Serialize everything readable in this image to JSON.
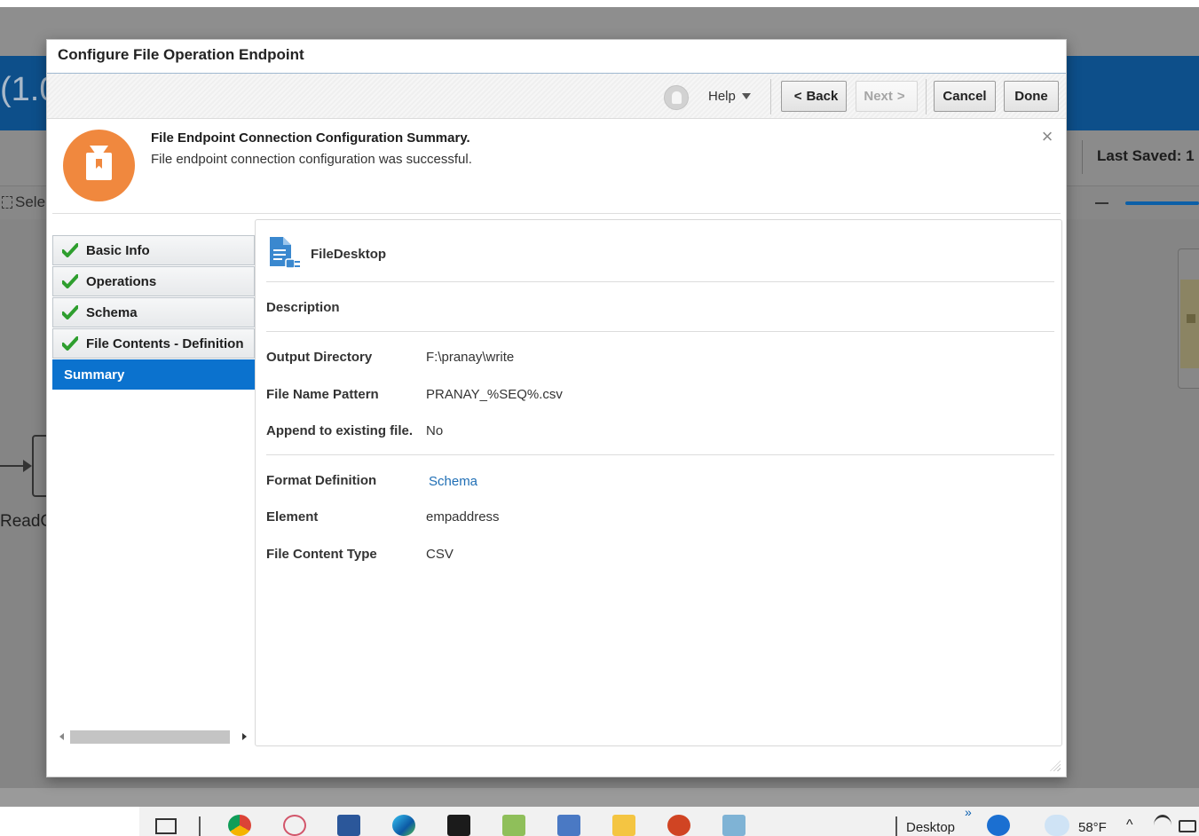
{
  "background_app": {
    "version_fragment": "(1.0",
    "last_saved_label": "Last Saved: 1",
    "select_label": "Sele",
    "node_label": "ReadC"
  },
  "dialog": {
    "title": "Configure File Operation Endpoint",
    "toolbar": {
      "help_label": "Help",
      "back_label": "Back",
      "back_chevron": "<",
      "next_label": "Next",
      "next_chevron": ">",
      "cancel_label": "Cancel",
      "done_label": "Done"
    },
    "message": {
      "title": "File Endpoint Connection Configuration Summary.",
      "text": "File endpoint connection configuration was successful.",
      "close_glyph": "×"
    },
    "nav": {
      "items": [
        {
          "label": "Basic Info",
          "completed": true
        },
        {
          "label": "Operations",
          "completed": true
        },
        {
          "label": "Schema",
          "completed": true
        },
        {
          "label": "File Contents - Definition",
          "completed": true
        },
        {
          "label": "Summary",
          "completed": false,
          "active": true
        }
      ]
    },
    "summary": {
      "endpoint_name": "FileDesktop",
      "description_label": "Description",
      "output_directory_label": "Output Directory",
      "output_directory_value": "F:\\pranay\\write",
      "file_name_pattern_label": "File Name Pattern",
      "file_name_pattern_value": "PRANAY_%SEQ%.csv",
      "append_label": "Append to existing file.",
      "append_value": "No",
      "format_definition_label": "Format Definition",
      "format_definition_value": "Schema",
      "element_label": "Element",
      "element_value": "empaddress",
      "file_content_type_label": "File Content Type",
      "file_content_type_value": "CSV"
    }
  },
  "taskbar": {
    "desktop_label": "Desktop",
    "temperature": "58°F",
    "overflow_glyph": "»"
  },
  "colors": {
    "accent_blue": "#0b72ce",
    "message_icon_orange": "#f0883e",
    "check_green": "#2e9e2e",
    "link_blue": "#1f6eb5"
  }
}
